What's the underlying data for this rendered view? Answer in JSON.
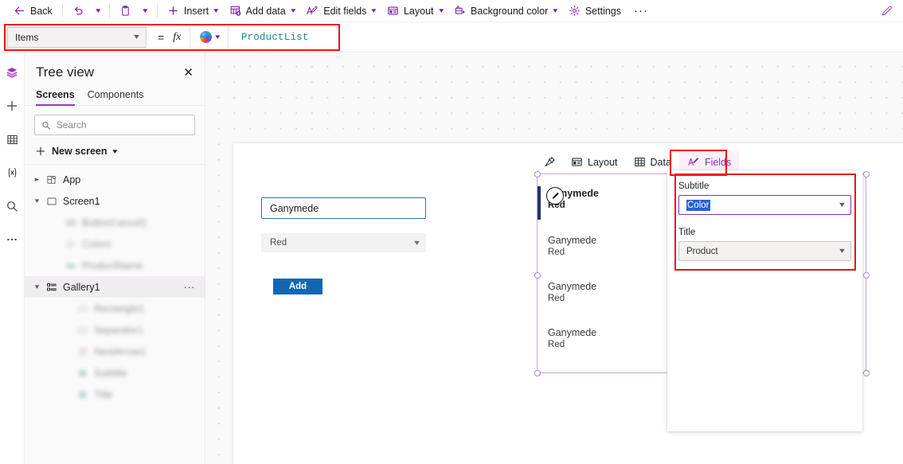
{
  "command_bar": {
    "items": [
      {
        "id": "back",
        "label": "Back",
        "icon": "arrow-left-icon",
        "has_chevron": false
      },
      {
        "id": "undo",
        "label": "",
        "icon": "undo-icon",
        "has_chevron": true
      },
      {
        "id": "paste",
        "label": "",
        "icon": "clipboard-icon",
        "has_chevron": true
      },
      {
        "id": "insert",
        "label": "Insert",
        "icon": "plus-icon",
        "has_chevron": true
      },
      {
        "id": "add-data",
        "label": "Add data",
        "icon": "add-data-icon",
        "has_chevron": true
      },
      {
        "id": "edit-fields",
        "label": "Edit fields",
        "icon": "edit-fields-icon",
        "has_chevron": true
      },
      {
        "id": "layout",
        "label": "Layout",
        "icon": "layout-icon",
        "has_chevron": true
      },
      {
        "id": "background-color",
        "label": "Background color",
        "icon": "background-color-icon",
        "has_chevron": true
      },
      {
        "id": "settings",
        "label": "Settings",
        "icon": "gear-icon",
        "has_chevron": false
      }
    ],
    "overflow_label": "···",
    "edit_pencil_icon": "pencil-icon"
  },
  "formula_bar": {
    "property": "Items",
    "equals_sign": "=",
    "fx_sign": "fx",
    "copilot_icon": "copilot-orb-icon",
    "formula": "ProductList",
    "formula_color": "#1e8a8a",
    "annotation_color": "#ee1111"
  },
  "left_rail": {
    "items": [
      {
        "id": "tree-view",
        "icon": "layers-icon",
        "active": true
      },
      {
        "id": "insert",
        "icon": "plus-icon",
        "active": false
      },
      {
        "id": "data",
        "icon": "table-icon",
        "active": false
      },
      {
        "id": "variables",
        "icon": "variables-x-icon",
        "active": false
      },
      {
        "id": "search",
        "icon": "search-icon",
        "active": false
      },
      {
        "id": "more",
        "icon": "ellipsis-icon",
        "active": false
      }
    ]
  },
  "tree_view": {
    "title": "Tree view",
    "close_icon": "close-icon",
    "tabs": [
      {
        "label": "Screens",
        "active": true
      },
      {
        "label": "Components",
        "active": false
      }
    ],
    "search_placeholder": "Search",
    "search_value": "",
    "search_icon": "search-icon",
    "new_screen_label": "New screen",
    "new_screen_icon": "plus-icon",
    "nodes": [
      {
        "label": "App",
        "icon": "app-icon",
        "twisty": "›",
        "indent": 0,
        "selected": false,
        "blurred": false
      },
      {
        "label": "Screen1",
        "icon": "screen-icon",
        "twisty": "⌄",
        "indent": 0,
        "selected": false,
        "blurred": false
      },
      {
        "label": "ButtonCancel1",
        "icon": "button-icon",
        "twisty": "",
        "indent": 1,
        "selected": false,
        "blurred": true
      },
      {
        "label": "Colors",
        "icon": "dropdown-icon",
        "twisty": "",
        "indent": 1,
        "selected": false,
        "blurred": true
      },
      {
        "label": "ProductName",
        "icon": "textinput-icon",
        "twisty": "",
        "indent": 1,
        "selected": false,
        "blurred": true
      },
      {
        "label": "Gallery1",
        "icon": "gallery-icon",
        "twisty": "⌄",
        "indent": 0,
        "selected": true,
        "blurred": false,
        "more_icon": "···"
      },
      {
        "label": "Rectangle1",
        "icon": "rectangle-icon",
        "twisty": "",
        "indent": 2,
        "selected": false,
        "blurred": true
      },
      {
        "label": "Separator1",
        "icon": "separator-icon",
        "twisty": "",
        "indent": 2,
        "selected": false,
        "blurred": true
      },
      {
        "label": "NextArrow1",
        "icon": "nextarrow-icon",
        "twisty": "",
        "indent": 2,
        "selected": false,
        "blurred": true
      },
      {
        "label": "Subtitle",
        "icon": "label-icon",
        "twisty": "",
        "indent": 2,
        "selected": false,
        "blurred": true
      },
      {
        "label": "Title",
        "icon": "label-icon",
        "twisty": "",
        "indent": 2,
        "selected": false,
        "blurred": true
      }
    ]
  },
  "canvas": {
    "app_form": {
      "text_input_value": "Ganymede",
      "dropdown_value": "Red",
      "dropdown_chevron_icon": "chevron-down-icon",
      "add_button_label": "Add"
    },
    "gallery": {
      "name": "Gallery1",
      "items": [
        {
          "title": "Ganymede",
          "subtitle": "Red",
          "selected": true
        },
        {
          "title": "Ganymede",
          "subtitle": "Red",
          "selected": false
        },
        {
          "title": "Ganymede",
          "subtitle": "Red",
          "selected": false
        },
        {
          "title": "Ganymede",
          "subtitle": "Red",
          "selected": false
        }
      ],
      "edit_pencil_icon": "pencil-circle-icon",
      "selection_border_color": "#c9a9d4"
    },
    "gallery_tabs": [
      {
        "id": "pin",
        "label": "",
        "icon": "pin-icon",
        "active": false
      },
      {
        "id": "layout",
        "label": "Layout",
        "icon": "layout-icon",
        "active": false
      },
      {
        "id": "data",
        "label": "Data",
        "icon": "data-grid-icon",
        "active": false
      },
      {
        "id": "fields",
        "label": "Fields",
        "icon": "fields-icon",
        "active": true
      }
    ]
  },
  "fields_panel": {
    "rows": [
      {
        "label": "Subtitle",
        "value": "Color",
        "focused": true,
        "value_selected": true,
        "chevron_icon": "chevron-down-icon"
      },
      {
        "label": "Title",
        "value": "Product",
        "focused": false,
        "value_selected": false,
        "chevron_icon": "chevron-down-icon"
      }
    ]
  },
  "colors": {
    "accent_purple": "#7719aa",
    "tab_active_purple": "#8c2fb0",
    "annotation_red": "#ee1111",
    "formula_teal": "#1e8a8a",
    "button_blue": "#1267b5",
    "selection_blue": "#2a5fd6"
  }
}
